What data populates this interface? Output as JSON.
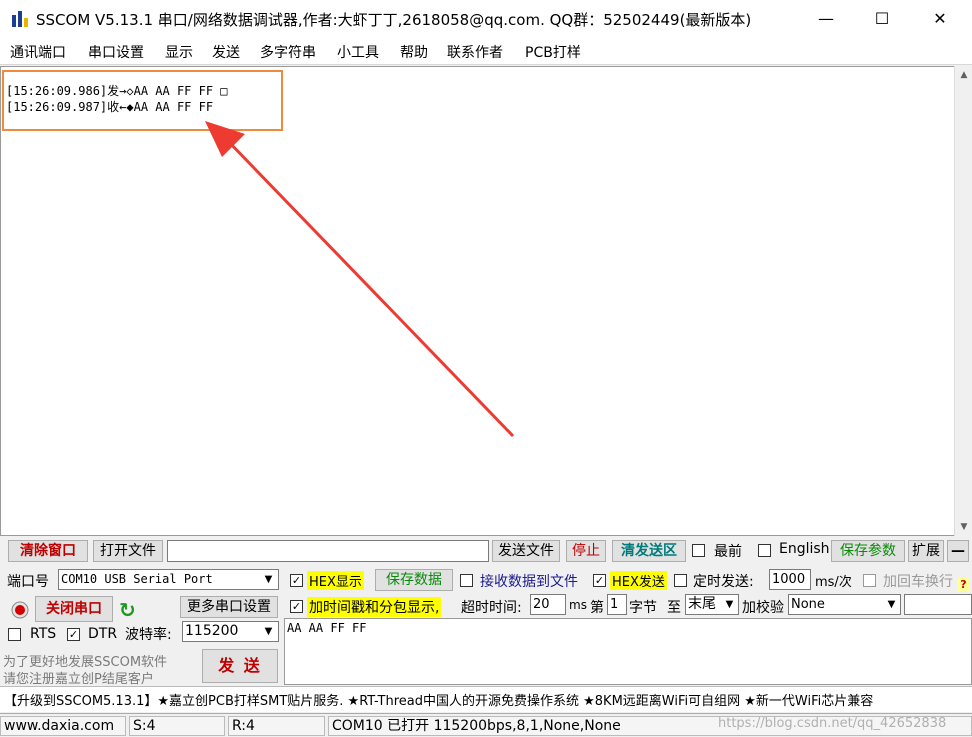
{
  "window": {
    "title": "SSCOM V5.13.1 串口/网络数据调试器,作者:大虾丁丁,2618058@qq.com. QQ群：52502449(最新版本)",
    "minimize": "—",
    "maximize": "☐",
    "close": "✕"
  },
  "menu": [
    "通讯端口",
    "串口设置",
    "显示",
    "发送",
    "多字符串",
    "小工具",
    "帮助",
    "联系作者",
    "PCB打样"
  ],
  "receive": {
    "lines": [
      "[15:26:09.986]发→◇AA AA FF FF □",
      "[15:26:09.987]收←◆AA AA FF FF"
    ]
  },
  "toolbar": {
    "clear_window": "清除窗口",
    "open_file": "打开文件",
    "file_path": "",
    "send_file": "发送文件",
    "stop": "停止",
    "clear_send": "清发送区",
    "topmost": "最前",
    "english": "English",
    "save_params": "保存参数",
    "expand": "扩展",
    "collapse": "—"
  },
  "port": {
    "label": "端口号",
    "value": "COM10 USB Serial Port",
    "close_button": "关闭串口",
    "more_settings": "更多串口设置",
    "rts": "RTS",
    "dtr": "DTR",
    "baud_label": "波特率:",
    "baud_value": "115200"
  },
  "options": {
    "hex_display": "HEX显示",
    "save_data": "保存数据",
    "recv_to_file": "接收数据到文件",
    "hex_send": "HEX发送",
    "timed_send": "定时发送:",
    "interval": "1000",
    "interval_unit": "ms/次",
    "add_newline": "加回车换行",
    "timestamp": "加时间戳和分包显示,",
    "timeout_label": "超时时间:",
    "timeout_value": "20",
    "timeout_unit": "ms",
    "byte_prefix": "第",
    "byte_index": "1",
    "byte_unit": "字节",
    "to_label": "至",
    "to_value": "末尾",
    "checksum_label": "加校验",
    "checksum_value": "None"
  },
  "send": {
    "text": "AA AA FF FF",
    "button": "发 送"
  },
  "promo": {
    "line1": "为了更好地发展SSCOM软件",
    "line2": "请您注册嘉立创P结尾客户"
  },
  "ticker": "【升级到SSCOM5.13.1】★嘉立创PCB打样SMT贴片服务. ★RT-Thread中国人的开源免费操作系统 ★8KM远距离WiFi可自组网 ★新一代WiFi芯片兼容",
  "status": {
    "website": "www.daxia.com",
    "sent": "S:4",
    "received": "R:4",
    "port_state": "COM10 已打开  115200bps,8,1,None,None",
    "watermark": "https://blog.csdn.net/qq_42652838"
  },
  "colors": {
    "annotation_box": "#f08a3c",
    "annotation_arrow": "#ee3b32",
    "highlight": "#ffff00"
  }
}
